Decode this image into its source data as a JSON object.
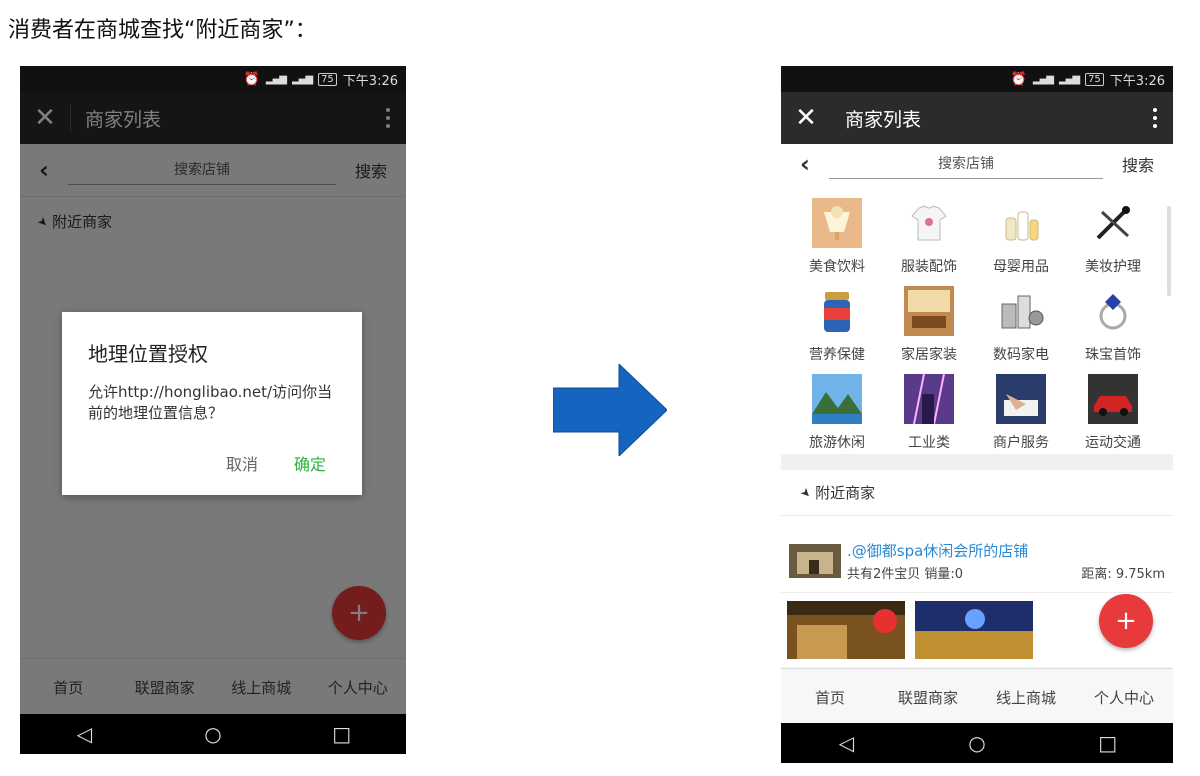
{
  "caption": "消费者在商城查找“附近商家”：",
  "status": {
    "time": "下午3:26",
    "battery": "75",
    "signal1": "2G",
    "signal2": "4G"
  },
  "app": {
    "title": "商家列表",
    "search_placeholder": "搜索店铺",
    "search_button": "搜索",
    "nearby_label": "附近商家"
  },
  "dialog": {
    "title": "地理位置授权",
    "body": "允许http://honglibao.net/访问你当前的地理位置信息？",
    "cancel": "取消",
    "confirm": "确定"
  },
  "categories": [
    {
      "label": "美食饮料",
      "icon": "drink-icon"
    },
    {
      "label": "服装配饰",
      "icon": "tshirt-icon"
    },
    {
      "label": "母婴用品",
      "icon": "baby-bottle-icon"
    },
    {
      "label": "美妆护理",
      "icon": "makeup-brush-icon"
    },
    {
      "label": "营养保健",
      "icon": "supplement-jar-icon"
    },
    {
      "label": "家居家装",
      "icon": "room-interior-icon"
    },
    {
      "label": "数码家电",
      "icon": "appliance-icon"
    },
    {
      "label": "珠宝首饰",
      "icon": "ring-icon"
    },
    {
      "label": "旅游休闲",
      "icon": "landscape-icon"
    },
    {
      "label": "工业类",
      "icon": "industry-icon"
    },
    {
      "label": "商户服务",
      "icon": "handshake-icon"
    },
    {
      "label": "运动交通",
      "icon": "car-icon"
    }
  ],
  "shop": {
    "name": ".@御都spa休闲会所的店铺",
    "stats": "共有2件宝贝 销量:0",
    "distance": "距离: 9.75km"
  },
  "bottom_nav": [
    "首页",
    "联盟商家",
    "线上商城",
    "个人中心"
  ],
  "fab": "+",
  "colors": {
    "fab": "#e83a3a",
    "confirm": "#2bb23f",
    "link": "#2a8ad4",
    "arrow": "#1565c0"
  }
}
